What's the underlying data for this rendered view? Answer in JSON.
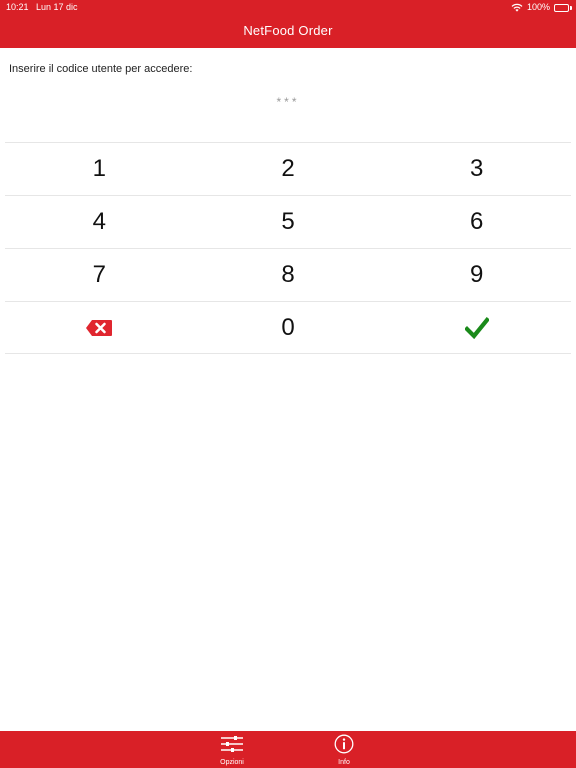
{
  "status_bar": {
    "time": "10:21",
    "date": "Lun 17 dic",
    "battery": "100%",
    "battery_level": 1.0
  },
  "header": {
    "title": "NetFood Order"
  },
  "login": {
    "prompt": "Inserire il codice utente per accedere:",
    "code_mask": "***"
  },
  "keypad": {
    "keys": [
      "1",
      "2",
      "3",
      "4",
      "5",
      "6",
      "7",
      "8",
      "9",
      "0"
    ],
    "delete_icon": "backspace-icon",
    "confirm_icon": "checkmark-icon"
  },
  "tabbar": {
    "items": [
      {
        "label": "Opzioni",
        "icon": "sliders-icon"
      },
      {
        "label": "Info",
        "icon": "info-icon"
      }
    ]
  },
  "colors": {
    "brand_red": "#d92027",
    "delete_red": "#e0262f",
    "confirm_green": "#1a8a1a",
    "code_gray": "#9a9a9a"
  }
}
